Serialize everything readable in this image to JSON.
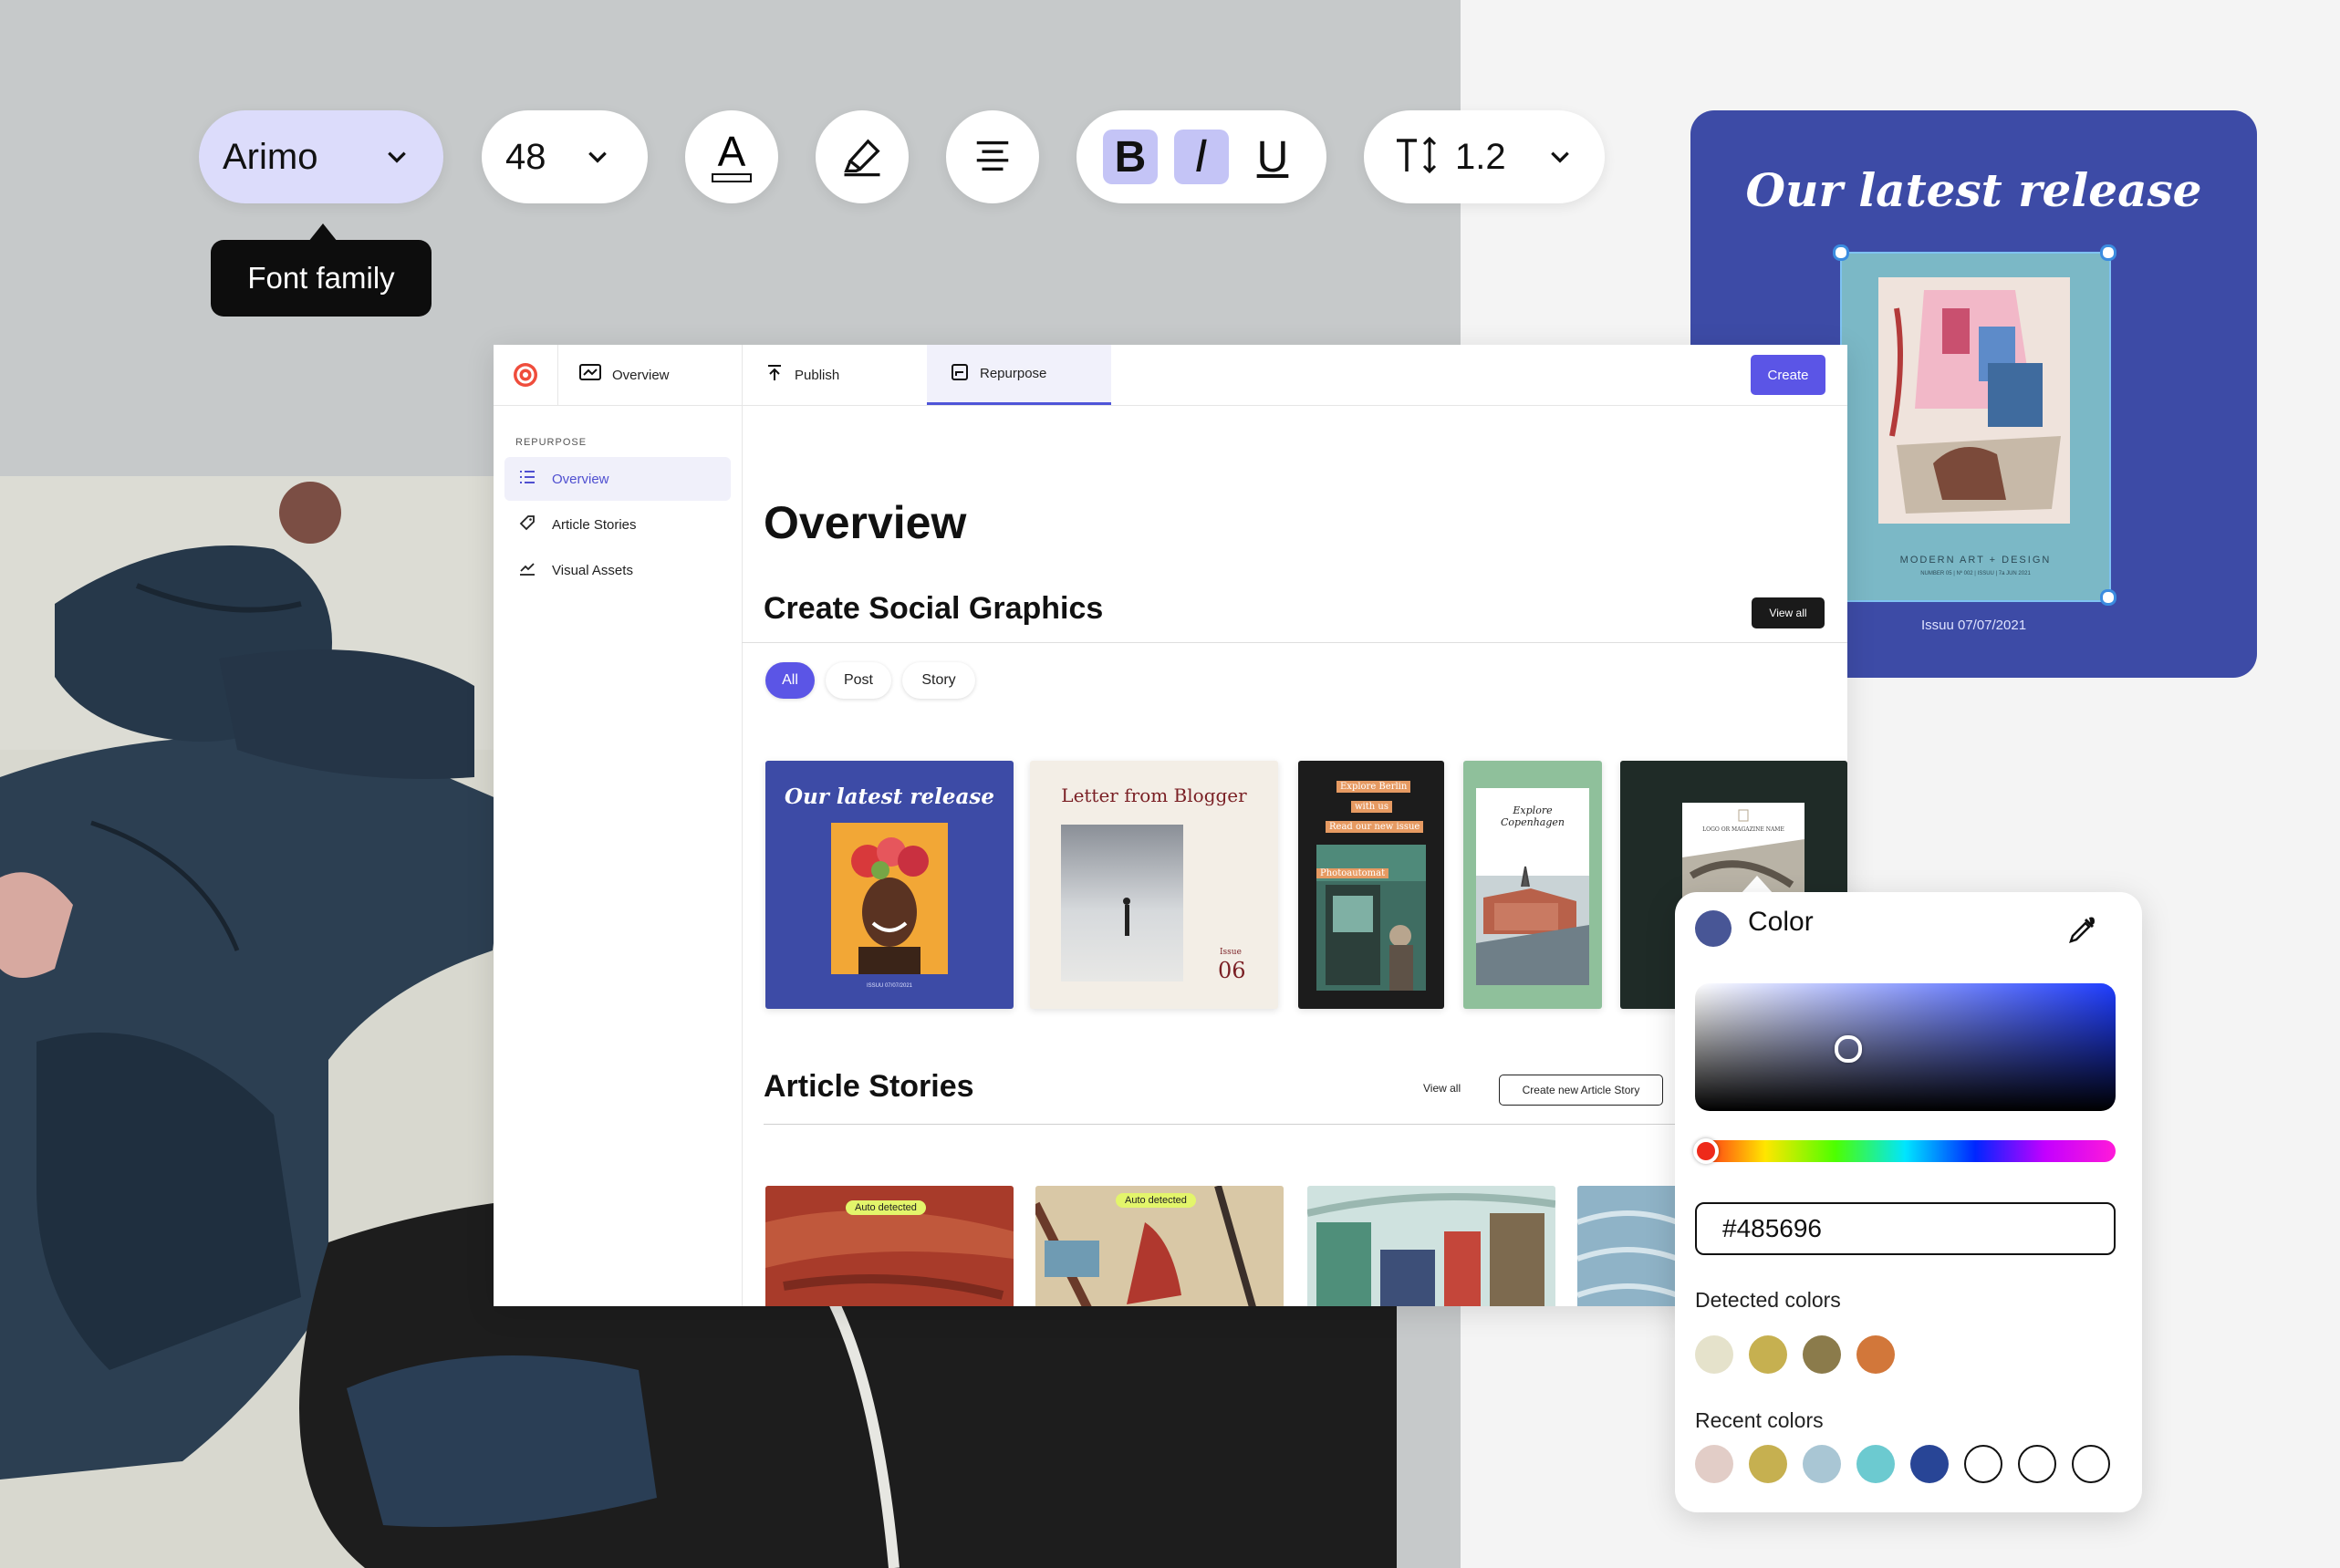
{
  "toolbar": {
    "font_family": "Arimo",
    "font_size": "48",
    "line_height": "1.2",
    "tooltip": "Font family",
    "bold": "B",
    "italic": "I",
    "underline": "U",
    "text_color_glyph": "A"
  },
  "poster": {
    "title": "Our latest release",
    "date": "Issuu 07/07/2021",
    "cover_title": "MODERN ART + DESIGN",
    "cover_sub": "NUMBER 05 | Nº 002 | ISSUU | 7a JUN 2021"
  },
  "app": {
    "tabs": [
      "Overview",
      "Publish",
      "Repurpose"
    ],
    "create_label": "Create",
    "sidebar": {
      "heading": "REPURPOSE",
      "items": [
        "Overview",
        "Article Stories",
        "Visual Assets"
      ]
    },
    "page_title": "Overview",
    "social": {
      "title": "Create Social Graphics",
      "view_all": "View all",
      "filters": [
        "All",
        "Post",
        "Story"
      ],
      "cards": [
        {
          "title": "Our latest release",
          "caption": "ISSUU 07/07/2021"
        },
        {
          "title": "Letter from Blogger",
          "issue_label": "Issue",
          "issue_no": "06"
        },
        {
          "lines": [
            "Explore Berlin",
            "with us",
            "Read our new issue"
          ],
          "sign": "Photoautomat"
        },
        {
          "title": "Explore Copenhagen"
        },
        {
          "caption": "LOGO OR MAGAZINE NAME"
        }
      ]
    },
    "stories": {
      "title": "Article Stories",
      "view_all": "View all",
      "create_new": "Create new Article Story",
      "badge": "Auto detected"
    }
  },
  "picker": {
    "title": "Color",
    "hex": "#485696",
    "detected_label": "Detected colors",
    "recent_label": "Recent colors",
    "detected_colors": [
      "#e5e2cb",
      "#c6b050",
      "#8b7b4b",
      "#d2773a"
    ],
    "recent_colors": [
      "#e2cdc7",
      "#c6b050",
      "#a9c6d4",
      "#6ccad0",
      "#284596",
      "#ffffff",
      "#ffffff",
      "#ffffff"
    ],
    "selected_color": "#485696"
  },
  "colors": {
    "accent": "#5b55e6",
    "poster_blue": "#3d4ba6"
  }
}
